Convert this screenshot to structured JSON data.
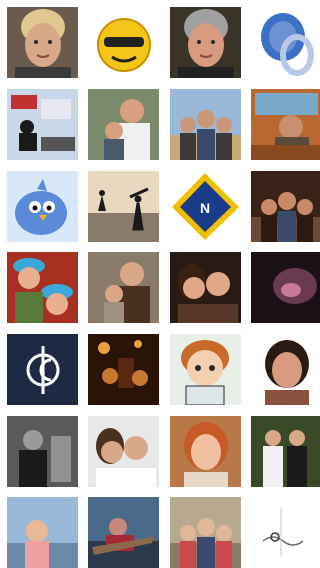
{
  "grid": {
    "tiles": [
      {
        "name": "avatar-blonde-woman",
        "bg": "#6b5a4e",
        "kind": "face",
        "skin": "#d8a88a",
        "hair": "#e0c890",
        "accent": "#3a3a3a"
      },
      {
        "name": "avatar-emoji-sunglasses",
        "bg": "#ffffff",
        "kind": "emoji",
        "skin": "#f5c518",
        "hair": "#222222",
        "accent": "#c89000"
      },
      {
        "name": "avatar-man-glasses",
        "bg": "#3a3328",
        "kind": "face",
        "skin": "#d89a80",
        "hair": "#a0a0a0",
        "accent": "#222222"
      },
      {
        "name": "avatar-jewel-ring",
        "bg": "#ffffff",
        "kind": "ring",
        "skin": "#3b6fc8",
        "hair": "#b8c8e8",
        "accent": "#8fa8d8"
      },
      {
        "name": "avatar-office-desk",
        "bg": "#c8d8e8",
        "kind": "office",
        "skin": "#1a1a1a",
        "hair": "#c03030",
        "accent": "#e8e8f0"
      },
      {
        "name": "avatar-man-child",
        "bg": "#7a8a6a",
        "kind": "pair",
        "skin": "#d8a080",
        "hair": "#f0f0f0",
        "accent": "#4a5a6a"
      },
      {
        "name": "avatar-family-outdoor",
        "bg": "#9ab8d8",
        "kind": "group",
        "skin": "#c89878",
        "hair": "#3a3a3a",
        "accent": "#c8a878"
      },
      {
        "name": "avatar-pilots-cockpit",
        "bg": "#b86830",
        "kind": "cockpit",
        "skin": "#c89070",
        "hair": "#5a4a3a",
        "accent": "#7aa8c8"
      },
      {
        "name": "avatar-blue-bird",
        "bg": "#d8e8f8",
        "kind": "bird",
        "skin": "#5a8ad8",
        "hair": "#ffffff",
        "accent": "#f0b020"
      },
      {
        "name": "avatar-beach-silhouette",
        "bg": "#b8a888",
        "kind": "beach",
        "skin": "#1a1a1a",
        "hair": "#e8d8c0",
        "accent": "#8a7a6a"
      },
      {
        "name": "avatar-ns-logo",
        "bg": "#f0c000",
        "kind": "logo",
        "skin": "#1a3a8a",
        "hair": "#ffffff",
        "accent": "#f0c000"
      },
      {
        "name": "avatar-three-men",
        "bg": "#3a2218",
        "kind": "group",
        "skin": "#c88a68",
        "hair": "#2a1a10",
        "accent": "#6a4a30"
      },
      {
        "name": "avatar-kids-blue-hats",
        "bg": "#a83020",
        "kind": "kids",
        "skin": "#e8b090",
        "hair": "#3aa8d8",
        "accent": "#5a7a3a"
      },
      {
        "name": "avatar-woman-baby",
        "bg": "#8a7a6a",
        "kind": "pair",
        "skin": "#d8a888",
        "hair": "#4a3020",
        "accent": "#a09080"
      },
      {
        "name": "avatar-couple-selfie",
        "bg": "#2a1a14",
        "kind": "couple",
        "skin": "#e0a888",
        "hair": "#3a2010",
        "accent": "#5a3828"
      },
      {
        "name": "avatar-dark-animal",
        "bg": "#1a1016",
        "kind": "dark",
        "skin": "#c87a98",
        "hair": "#2a1a22",
        "accent": "#6a3a50"
      },
      {
        "name": "avatar-carlton-logo",
        "bg": "#1e2a44",
        "kind": "carlton",
        "skin": "#ffffff",
        "hair": "#1e2a44",
        "accent": "#ffffff"
      },
      {
        "name": "avatar-night-party",
        "bg": "#2a1408",
        "kind": "night",
        "skin": "#e8a040",
        "hair": "#5a2810",
        "accent": "#c87830"
      },
      {
        "name": "avatar-cartoon-boy",
        "bg": "#e8eee8",
        "kind": "cartoon",
        "skin": "#f2d0b0",
        "hair": "#c86a28",
        "accent": "#2a2a2a"
      },
      {
        "name": "avatar-smiling-woman",
        "bg": "#ffffff",
        "kind": "portrait",
        "skin": "#d89a80",
        "hair": "#2a1a14",
        "accent": "#8a5040"
      },
      {
        "name": "avatar-photographer-bw",
        "bg": "#5a5a5a",
        "kind": "bw",
        "skin": "#9a9a9a",
        "hair": "#1a1a1a",
        "accent": "#c8c8c8"
      },
      {
        "name": "avatar-couple-white",
        "bg": "#e8e8e8",
        "kind": "couple",
        "skin": "#d8a888",
        "hair": "#4a3020",
        "accent": "#ffffff"
      },
      {
        "name": "avatar-redhead-woman",
        "bg": "#b87848",
        "kind": "portrait",
        "skin": "#f0c0a0",
        "hair": "#c85a28",
        "accent": "#e8d8c8"
      },
      {
        "name": "avatar-wedding-couple",
        "bg": "#3a4a28",
        "kind": "wedding",
        "skin": "#d8a888",
        "hair": "#1a1a1a",
        "accent": "#f0f0f0"
      },
      {
        "name": "avatar-girl-city",
        "bg": "#9ab8d8",
        "kind": "girl",
        "skin": "#e8b898",
        "hair": "#f0a0a0",
        "accent": "#6a8aa8"
      },
      {
        "name": "avatar-boat-ride",
        "bg": "#4a6a8a",
        "kind": "boat",
        "skin": "#c88a78",
        "hair": "#a82838",
        "accent": "#2a3a4a"
      },
      {
        "name": "avatar-girls-outdoor",
        "bg": "#b8a890",
        "kind": "group",
        "skin": "#e0b898",
        "hair": "#c84a4a",
        "accent": "#8a7a68"
      },
      {
        "name": "avatar-sketch",
        "bg": "#ffffff",
        "kind": "sketch",
        "skin": "#6a6a6a",
        "hair": "#c8c8c8",
        "accent": "#3a3a3a"
      }
    ]
  }
}
